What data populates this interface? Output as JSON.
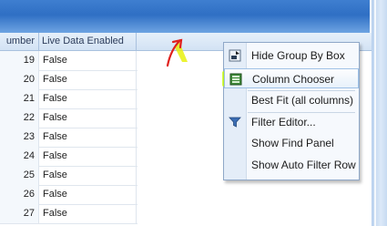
{
  "grid": {
    "columns": {
      "number_header": "umber",
      "live_header": "Live Data Enabled"
    },
    "rows": [
      {
        "number": "19",
        "live": "False"
      },
      {
        "number": "20",
        "live": "False"
      },
      {
        "number": "21",
        "live": "False"
      },
      {
        "number": "22",
        "live": "False"
      },
      {
        "number": "23",
        "live": "False"
      },
      {
        "number": "24",
        "live": "False"
      },
      {
        "number": "25",
        "live": "False"
      },
      {
        "number": "26",
        "live": "False"
      },
      {
        "number": "27",
        "live": "False"
      }
    ]
  },
  "context_menu": {
    "items": [
      {
        "label": "Hide Group By Box",
        "icon": "group-by-box-icon"
      },
      {
        "label": "Column Chooser",
        "icon": "column-chooser-icon",
        "state": "highlighted"
      },
      {
        "label": "Best Fit (all columns)",
        "icon": ""
      },
      {
        "label": "Filter Editor...",
        "icon": "filter-icon"
      },
      {
        "label": "Show Find Panel",
        "icon": ""
      },
      {
        "label": "Show Auto Filter Row",
        "icon": ""
      }
    ]
  },
  "colors": {
    "header_gradient_top": "#3f7fd0",
    "grid_header_bg": "#d2e2f4",
    "menu_bg": "#f6f9fd",
    "highlight_marker": "#c8ff00",
    "annotation_arrow": "#e0201c"
  }
}
